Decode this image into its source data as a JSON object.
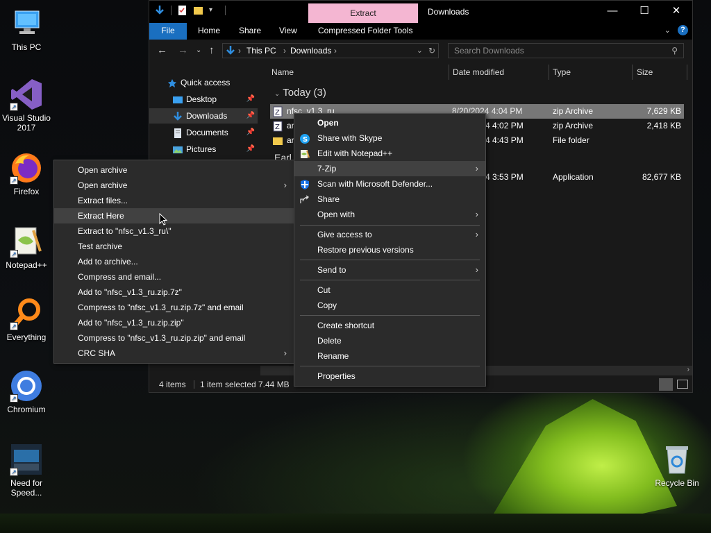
{
  "desktop_icons": [
    {
      "label": "This PC",
      "icon": "computer-icon"
    },
    {
      "label": "Visual Studio 2017",
      "icon": "visual-studio-icon"
    },
    {
      "label": "Firefox",
      "icon": "firefox-icon"
    },
    {
      "label": "Notepad++",
      "icon": "notepad-plus-plus-icon"
    },
    {
      "label": "Everything",
      "icon": "everything-search-icon"
    },
    {
      "label": "Chromium",
      "icon": "chromium-icon"
    },
    {
      "label": "Need for Speed...",
      "icon": "nfs-game-icon"
    },
    {
      "label": "Recycle Bin",
      "icon": "recycle-bin-icon"
    }
  ],
  "explorer": {
    "title": "Downloads",
    "contextual_tab": "Extract",
    "ribbon_tabs": [
      "File",
      "Home",
      "Share",
      "View",
      "Compressed Folder Tools"
    ],
    "address": {
      "segments": [
        "This PC",
        "Downloads"
      ]
    },
    "search_placeholder": "Search Downloads",
    "nav": {
      "quick_access": "Quick access",
      "items": [
        {
          "label": "Desktop",
          "pinned": true
        },
        {
          "label": "Downloads",
          "pinned": true,
          "selected": true
        },
        {
          "label": "Documents",
          "pinned": true
        },
        {
          "label": "Pictures",
          "pinned": true
        }
      ]
    },
    "columns": [
      "Name",
      "Date modified",
      "Type",
      "Size"
    ],
    "groups": [
      {
        "label": "Today (3)"
      },
      {
        "label": "Earl"
      }
    ],
    "rows": [
      {
        "name": "nfsc_v1.3_ru",
        "date": "8/20/2024 4:04 PM",
        "type": "zip Archive",
        "size": "7,629 KB",
        "selected": true
      },
      {
        "name": "ar",
        "date": "4 4:02 PM",
        "type": "zip Archive",
        "size": "2,418 KB"
      },
      {
        "name": "ar",
        "date": "4 4:43 PM",
        "type": "File folder",
        "size": ""
      },
      {
        "name": "",
        "date": "4 3:53 PM",
        "type": "Application",
        "size": "82,677 KB"
      }
    ],
    "status": {
      "items": "4 items",
      "selected": "1 item selected",
      "size": "7.44 MB"
    }
  },
  "main_menu": {
    "items": [
      {
        "label": "Open",
        "bold": true
      },
      {
        "label": "Share with Skype",
        "icon": "skype-icon"
      },
      {
        "label": "Edit with Notepad++",
        "icon": "notepad-plus-plus-icon"
      },
      {
        "label": "7-Zip",
        "submenu": true,
        "highlighted": true
      },
      {
        "label": "Scan with Microsoft Defender...",
        "icon": "defender-shield-icon"
      },
      {
        "label": "Share",
        "icon": "share-icon"
      },
      {
        "label": "Open with",
        "submenu": true
      },
      {
        "label": "Give access to",
        "submenu": true
      },
      {
        "label": "Restore previous versions"
      },
      {
        "label": "Send to",
        "submenu": true
      },
      {
        "label": "Cut"
      },
      {
        "label": "Copy"
      },
      {
        "label": "Create shortcut"
      },
      {
        "label": "Delete"
      },
      {
        "label": "Rename"
      },
      {
        "label": "Properties"
      }
    ]
  },
  "zip_menu": {
    "items": [
      {
        "label": "Open archive"
      },
      {
        "label": "Open archive",
        "submenu": true
      },
      {
        "label": "Extract files..."
      },
      {
        "label": "Extract Here",
        "highlighted": true
      },
      {
        "label": "Extract to \"nfsc_v1.3_ru\\\""
      },
      {
        "label": "Test archive"
      },
      {
        "label": "Add to archive..."
      },
      {
        "label": "Compress and email..."
      },
      {
        "label": "Add to \"nfsc_v1.3_ru.zip.7z\""
      },
      {
        "label": "Compress to \"nfsc_v1.3_ru.zip.7z\" and email"
      },
      {
        "label": "Add to \"nfsc_v1.3_ru.zip.zip\""
      },
      {
        "label": "Compress to \"nfsc_v1.3_ru.zip.zip\" and email"
      },
      {
        "label": "CRC SHA",
        "submenu": true
      }
    ]
  },
  "colors": {
    "accent": "#1a6fc0",
    "contextual_tab": "#f4b6d2",
    "menu_bg": "#2b2b2b",
    "menu_highlight": "#414141"
  }
}
